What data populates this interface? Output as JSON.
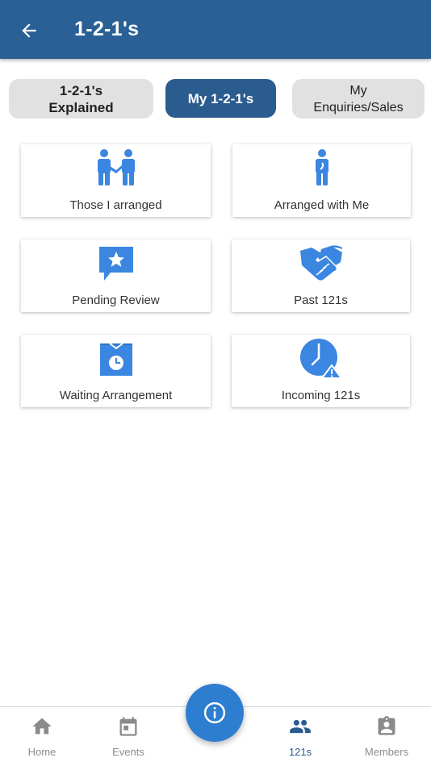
{
  "header": {
    "title": "1-2-1's",
    "back_icon": "arrow-left-icon"
  },
  "tabs": [
    {
      "line1": "1-2-1's",
      "line2": "Explained",
      "active": false
    },
    {
      "line1": "My 1-2-1's",
      "active": true
    },
    {
      "line1": "My",
      "line2": "Enquiries/Sales",
      "active": false
    }
  ],
  "cards": [
    {
      "label": "Those I arranged",
      "icon": "two-people-icon"
    },
    {
      "label": "Arranged with Me",
      "icon": "person-icon"
    },
    {
      "label": "Pending Review",
      "icon": "star-chat-icon"
    },
    {
      "label": "Past 121s",
      "icon": "handshake-icon"
    },
    {
      "label": "Waiting Arrangement",
      "icon": "calendar-clock-icon"
    },
    {
      "label": "Incoming 121s",
      "icon": "clock-alert-icon"
    }
  ],
  "nav": {
    "home": "Home",
    "events": "Events",
    "ones": "121s",
    "members": "Members",
    "active": "121s"
  },
  "colors": {
    "header": "#2b6096",
    "active_tab": "#2b5c90",
    "icon_blue": "#3a86e0",
    "fab": "#2d7ed0",
    "nav_inactive": "#8b8b8b"
  }
}
